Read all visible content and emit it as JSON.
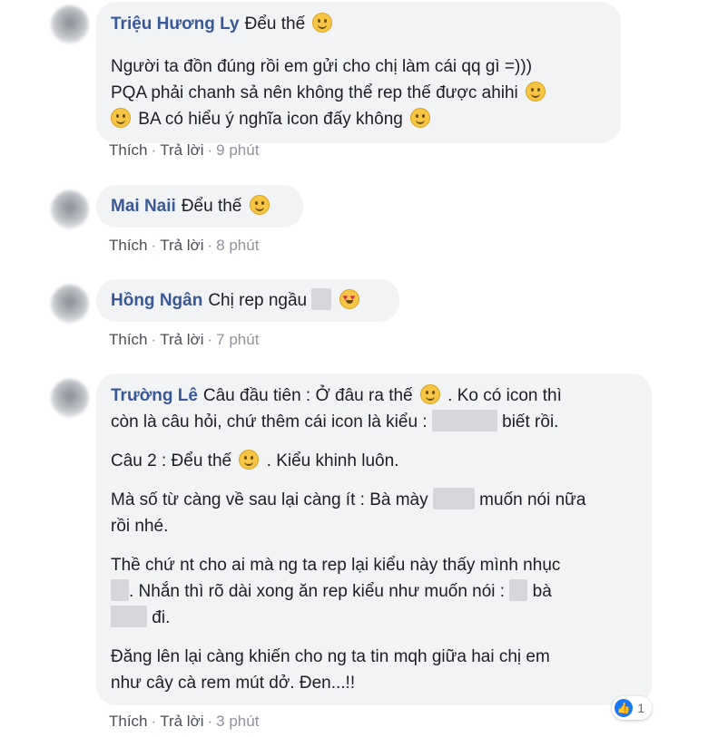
{
  "comments": [
    {
      "author": "Triệu Hương Ly",
      "first_line": "Đểu thế",
      "lines": [
        "Người ta đồn đúng rồi em gửi cho chị làm cái qq gì =)))",
        "PQA phải chanh sả nên không thể rep thế được ahihi",
        "BA có hiểu ý nghĩa icon đấy không"
      ],
      "actions": {
        "like": "Thích",
        "reply": "Trả lời",
        "time": "9 phút"
      }
    },
    {
      "author": "Mai Naii",
      "first_line": "Đểu thế",
      "actions": {
        "like": "Thích",
        "reply": "Trả lời",
        "time": "8 phút"
      }
    },
    {
      "author": "Hồng Ngân",
      "first_line": "Chị rep ngầu",
      "actions": {
        "like": "Thích",
        "reply": "Trả lời",
        "time": "7 phút"
      }
    },
    {
      "author": "Trường Lê",
      "p1": {
        "a": "Câu đầu tiên : Ở đâu ra thế",
        "b": ". Ko có icon thì",
        "c": "còn là câu hỏi, chứ thêm cái icon là kiểu :",
        "d": "biết rồi."
      },
      "p2": {
        "a": "Câu 2 : Đểu thế",
        "b": ". Kiểu khinh luôn."
      },
      "p3": {
        "a": "Mà số từ càng về sau lại càng ít : Bà mày",
        "b": "muốn nói nữa",
        "c": "rồi nhé."
      },
      "p4": {
        "a": "Thề chứ nt cho ai mà ng ta rep lại kiểu này thấy mình nhục",
        "b": ". Nhắn thì rõ dài xong ăn rep kiểu như muốn nói :",
        "c": "bà",
        "d": "đi."
      },
      "p5": {
        "a": "Đăng lên lại càng khiến cho ng ta tin mqh giữa hai chị em",
        "b": "như cây cà rem mút dở. Đen...!!"
      },
      "reaction_count": "1",
      "actions": {
        "like": "Thích",
        "reply": "Trả lời",
        "time": "3 phút"
      }
    }
  ],
  "separator": "·"
}
